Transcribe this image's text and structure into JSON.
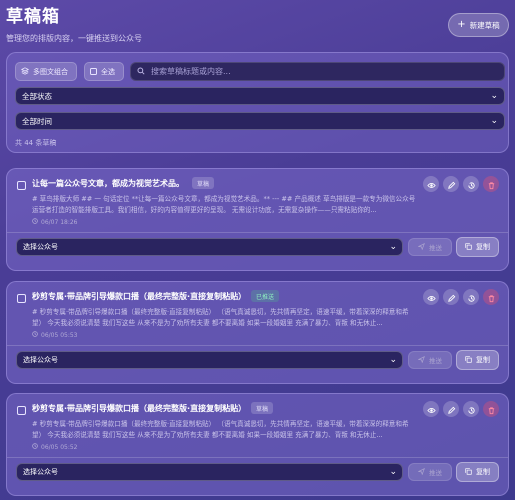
{
  "header": {
    "title": "草稿箱",
    "subtitle": "管理您的排版内容，一键推送到公众号",
    "new_button": "新建草稿"
  },
  "filters": {
    "multi_label": "多图文组合",
    "select_all_label": "全选",
    "search_placeholder": "搜索草稿标题或内容...",
    "status_select": "全部状态",
    "time_select": "全部时间",
    "count_text": "共 44 条草稿"
  },
  "cards": [
    {
      "title": "让每一篇公众号文章，都成为视觉艺术品。",
      "badge": "草稿",
      "badge_type": "draft",
      "excerpt": "# 草鸟排版大师 ## 一 句话定位 **让每一篇公众号文章，都成为视觉艺术品。** --- ## 产品概述 草鸟排版是一款专为微信公众号运营者打造的智能排版工具。我们相信，好的内容值得更好的呈现。 无需设计功底，无需复杂操作——只需粘贴你的...",
      "date": "06/07 18:26",
      "account_select": "选择公众号",
      "push_label": "推送",
      "copy_label": "复制"
    },
    {
      "title": "秒剪专属·带品牌引导爆款口播（最终完整版·直接复制粘贴）",
      "badge": "已推送",
      "badge_type": "pushed",
      "excerpt": "# 秒剪专属·带品牌引导爆款口播（最终完整版·直接复制粘贴） （语气真诚恳切，先共情再坚定，语速平缓，带着深深的释意和希望） 今天我必须说清楚 我们写这些 从来不是为了劝所有夫妻 都不要离婚 如果一段婚姻里 充满了暴力、背叛 和无休止...",
      "date": "06/05 05:53",
      "account_select": "选择公众号",
      "push_label": "推送",
      "copy_label": "复制"
    },
    {
      "title": "秒剪专属·带品牌引导爆款口播（最终完整版·直接复制粘贴）",
      "badge": "草稿",
      "badge_type": "draft",
      "excerpt": "# 秒剪专属·带品牌引导爆款口播（最终完整版·直接复制粘贴） （语气真诚恳切，先共情再坚定，语速平缓，带着深深的释意和希望） 今天我必须说清楚 我们写这些 从来不是为了劝所有夫妻 都不要离婚 如果一段婚姻里 充满了暴力、背叛 和无休止...",
      "date": "06/05 05:52",
      "account_select": "选择公众号",
      "push_label": "推送",
      "copy_label": "复制"
    }
  ],
  "colors": {
    "background": "#4a3d96",
    "delete_accent": "#f0506e",
    "pushed_badge": "#8ef0c0"
  },
  "icons": [
    "plus-icon",
    "layers-icon",
    "checkbox-icon",
    "search-icon",
    "chevron-down-icon",
    "eye-icon",
    "edit-icon",
    "history-icon",
    "trash-icon",
    "clock-icon",
    "send-icon",
    "copy-icon"
  ]
}
